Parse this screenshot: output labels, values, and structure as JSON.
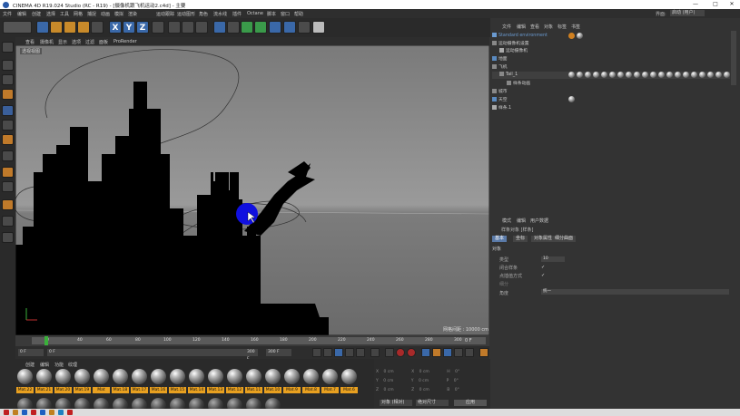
{
  "window": {
    "title": "CINEMA 4D R19.024 Studio (RC - R19) - [摄像机跟飞机运动2.c4d] - 主要",
    "controls": [
      "—",
      "□",
      "✕"
    ]
  },
  "menubar": {
    "items": [
      "文件",
      "编辑",
      "创建",
      "选择",
      "工具",
      "网格",
      "捕捉",
      "动画",
      "模拟",
      "渲染",
      "运动跟踪",
      "运动图形",
      "角色",
      "流水线",
      "插件",
      "Octane",
      "脚本",
      "窗口",
      "帮助"
    ],
    "layout_label": "界面:",
    "layout_value": "启动 (用户)"
  },
  "toolbar": {
    "axis_labels": [
      "X",
      "Y",
      "Z"
    ]
  },
  "viewport": {
    "menu": [
      "查看",
      "摄像机",
      "显示",
      "选项",
      "过滤",
      "面板",
      "ProRender"
    ],
    "label": "透视视图",
    "grid_info": "网格间距 : 10000 cm"
  },
  "timeline": {
    "ticks": [
      "0",
      "20",
      "40",
      "60",
      "80",
      "100",
      "120",
      "140",
      "160",
      "180",
      "200",
      "220",
      "240",
      "260",
      "280",
      "300"
    ],
    "end_frame": "0 F",
    "current_frame": "0 F",
    "start_field": "0 F",
    "end_field": "300 F",
    "preview_end": "300 F",
    "playhead_frame": 10
  },
  "materials": {
    "menu": [
      "创建",
      "编辑",
      "功能",
      "纹理"
    ],
    "row1": [
      "Mat.22",
      "Mat.21",
      "Mat.20",
      "Mat.19",
      "Mat",
      "Mat.18",
      "Mat.17",
      "Mat.16",
      "Mat.15",
      "Mat.14",
      "Mat.13",
      "Mat.12",
      "Mat.11",
      "Mat.10",
      "Mat.9",
      "Mat.8",
      "Mat.7",
      "Mat.6"
    ]
  },
  "coordinates": {
    "rows": [
      {
        "a": "X",
        "av": "0 cm",
        "b": "X",
        "bv": "0 cm",
        "c": "H",
        "cv": "0°"
      },
      {
        "a": "Y",
        "av": "0 cm",
        "b": "Y",
        "bv": "0 cm",
        "c": "P",
        "cv": "0°"
      },
      {
        "a": "Z",
        "av": "0 cm",
        "b": "Z",
        "bv": "0 cm",
        "c": "B",
        "cv": "0°"
      }
    ],
    "mode": "对象 (相对)",
    "size_mode": "绝对尺寸",
    "apply": "应用"
  },
  "object_manager": {
    "menu": [
      "文件",
      "编辑",
      "查看",
      "对象",
      "标签",
      "书签"
    ],
    "objects": [
      {
        "name": "Standard environment",
        "indent": 0,
        "color": "#6a9ad0"
      },
      {
        "name": "运动摄像机设置",
        "indent": 0,
        "color": "#c0c0c0"
      },
      {
        "name": "运动摄像机",
        "indent": 1,
        "color": "#c0c0c0"
      },
      {
        "name": "地面",
        "indent": 0,
        "color": "#c0c0c0"
      },
      {
        "name": "飞机",
        "indent": 0,
        "color": "#c0c0c0"
      },
      {
        "name": "Tail_1",
        "indent": 1,
        "color": "#c0c0c0"
      },
      {
        "name": "样条动画",
        "indent": 2,
        "color": "#c0c0c0"
      },
      {
        "name": "城市",
        "indent": 0,
        "color": "#c0c0c0"
      },
      {
        "name": "天空",
        "indent": 0,
        "color": "#c0c0c0"
      },
      {
        "name": "样条.1",
        "indent": 0,
        "color": "#c0c0c0"
      }
    ]
  },
  "attribute_manager": {
    "menu": [
      "模式",
      "编辑",
      "用户数据"
    ],
    "title": "样条对象 [样条]",
    "tabs": [
      "基本",
      "坐标",
      "对象属性",
      "细分曲面"
    ],
    "active_tab": 0,
    "section": "对象",
    "fields": [
      {
        "label": "类型",
        "value": "线性"
      },
      {
        "label": "闭合样条",
        "value": "✓"
      },
      {
        "label": "点插值方式",
        "value": "✓"
      },
      {
        "label": "细分",
        "value": ""
      },
      {
        "label": "角度",
        "value": "5°"
      }
    ],
    "type_select": "线性",
    "count_value": "10",
    "interp_select": "统一"
  },
  "colors": {
    "accent": "#3a68a8",
    "mat_label": "#e8a020",
    "playhead": "#3ab03a",
    "cursor_ball": "#1010e0"
  }
}
